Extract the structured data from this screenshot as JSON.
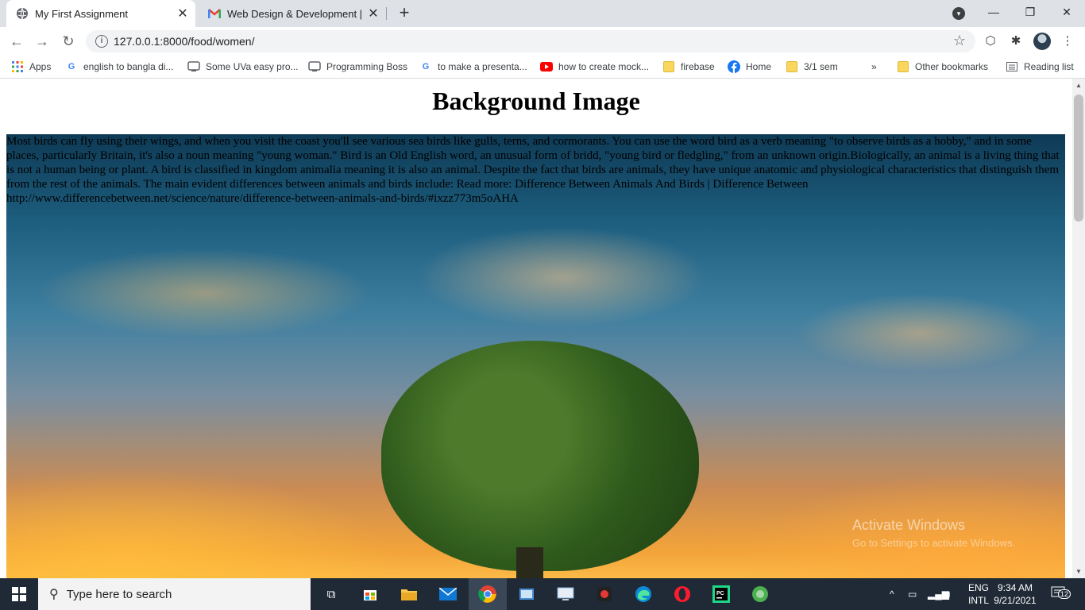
{
  "browser": {
    "tabs": [
      {
        "title": "My First Assignment"
      },
      {
        "title": "Web Design & Development | Ba"
      }
    ],
    "url": "127.0.0.1:8000/food/women/",
    "bookmarks": [
      {
        "label": "Apps"
      },
      {
        "label": "english to bangla di..."
      },
      {
        "label": "Some UVa easy pro..."
      },
      {
        "label": "Programming Boss"
      },
      {
        "label": "to make a presenta..."
      },
      {
        "label": "how to create mock..."
      },
      {
        "label": "firebase"
      },
      {
        "label": "Home"
      },
      {
        "label": "3/1 sem"
      }
    ],
    "overflow_label": "»",
    "other_bookmarks": "Other bookmarks",
    "reading_list": "Reading list"
  },
  "page": {
    "heading": "Background Image",
    "paragraph": "Most birds can fly using their wings, and when you visit the coast you'll see various sea birds like gulls, terns, and cormorants. You can use the word bird as a verb meaning \"to observe birds as a hobby,\" and in some places, particularly Britain, it's also a noun meaning \"young woman.\" Bird is an Old English word, an unusual form of bridd, \"young bird or fledgling,\" from an unknown origin.Biologically, an animal is a living thing that is not a human being or plant. A bird is classified in kingdom animalia meaning it is also an animal. Despite the fact that birds are animals, they have unique anatomic and physiological characteristics that distinguish them from the rest of the animals. The main evident differences between animals and birds include: Read more: Difference Between Animals And Birds | Difference Between http://www.differencebetween.net/science/nature/difference-between-animals-and-birds/#ixzz773m5oAHA",
    "watermark_title": "Activate Windows",
    "watermark_sub": "Go to Settings to activate Windows."
  },
  "taskbar": {
    "search_placeholder": "Type here to search",
    "lang_top": "ENG",
    "lang_bottom": "INTL",
    "time": "9:34 AM",
    "date": "9/21/2021",
    "notification_count": "12"
  }
}
